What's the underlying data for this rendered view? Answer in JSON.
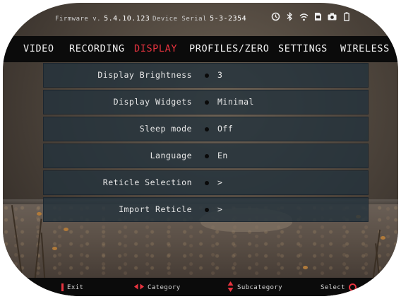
{
  "status": {
    "firmware_label": "Firmware v.",
    "firmware_value": "5.4.10.123",
    "serial_label": "Device Serial",
    "serial_value": "5-3-2354",
    "icons": [
      "timer-icon",
      "bluetooth-icon",
      "wifi-icon",
      "sd-card-icon",
      "camera-icon",
      "battery-icon"
    ]
  },
  "tabs": [
    {
      "label": "VIDEO",
      "active": false
    },
    {
      "label": "RECORDING",
      "active": false
    },
    {
      "label": "DISPLAY",
      "active": true
    },
    {
      "label": "PROFILES/ZERO",
      "active": false
    },
    {
      "label": "SETTINGS",
      "active": false
    },
    {
      "label": "WIRELESS",
      "active": false
    }
  ],
  "menu": [
    {
      "label": "Display Brightness",
      "value": "3"
    },
    {
      "label": "Display Widgets",
      "value": "Minimal"
    },
    {
      "label": "Sleep mode",
      "value": "Off"
    },
    {
      "label": "Language",
      "value": "En"
    },
    {
      "label": "Reticle Selection",
      "value": ">"
    },
    {
      "label": "Import Reticle",
      "value": ">"
    }
  ],
  "footer": {
    "exit": "Exit",
    "category": "Category",
    "subcategory": "Subcategory",
    "select": "Select"
  },
  "colors": {
    "accent": "#e8333f",
    "row_bg": "#23323c",
    "bar_bg": "#0b0b0b"
  }
}
